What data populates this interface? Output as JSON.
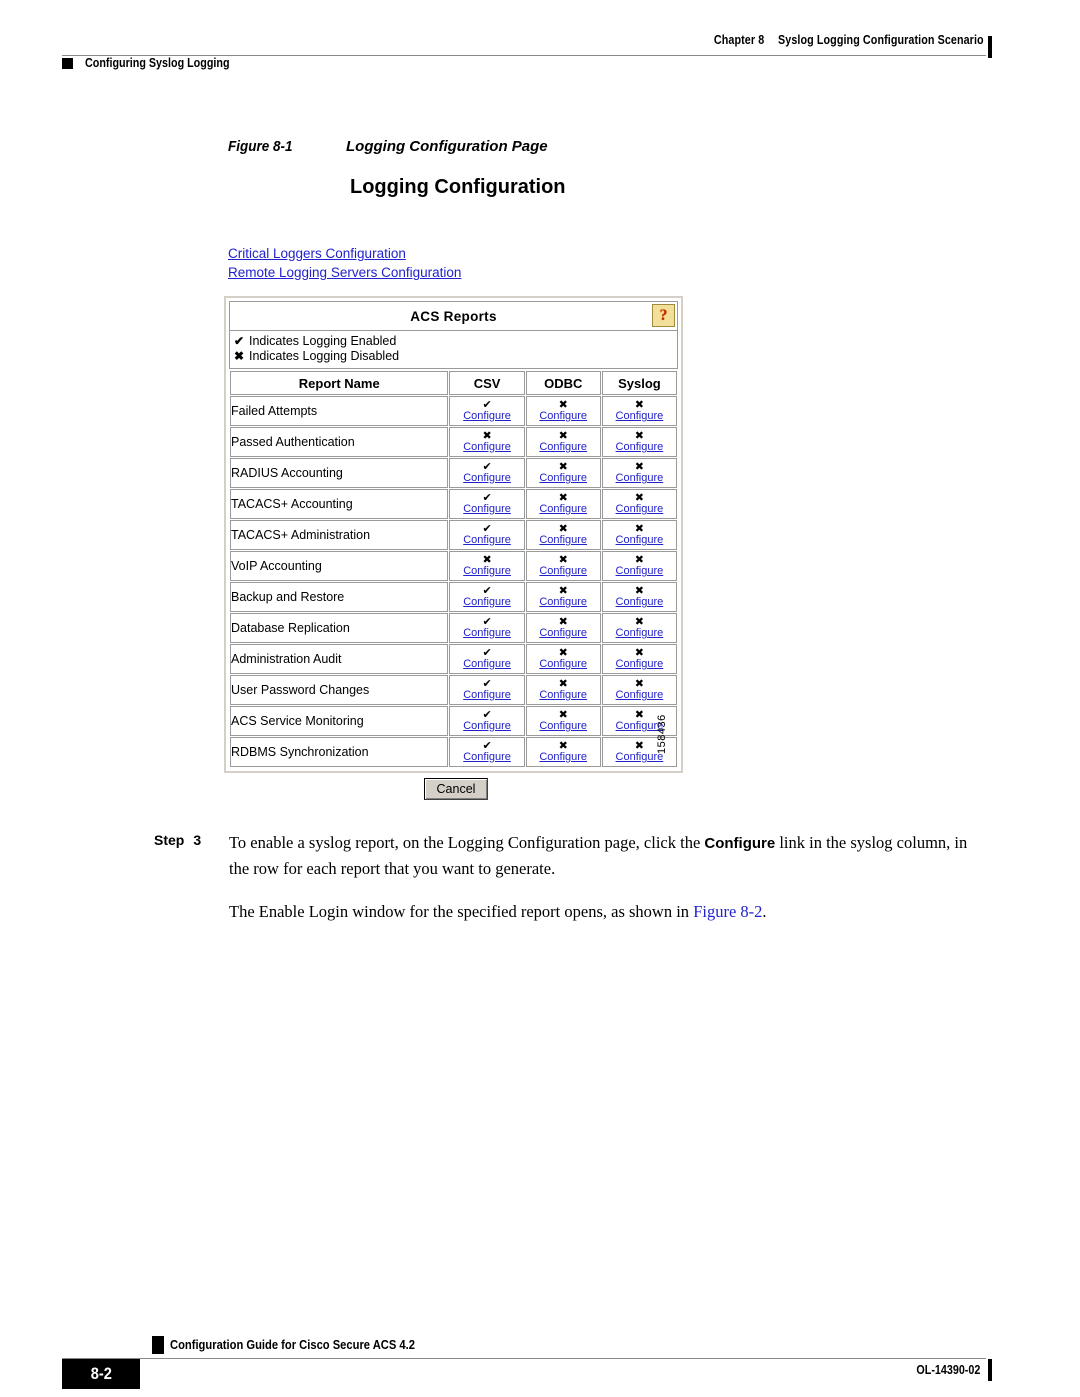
{
  "header": {
    "chapter": "Chapter 8",
    "chapter_title": "Syslog Logging Configuration Scenario",
    "section": "Configuring Syslog Logging"
  },
  "figure": {
    "number": "Figure 8-1",
    "title": "Logging Configuration Page",
    "figure_id": "158436"
  },
  "screenshot": {
    "page_title": "Logging Configuration",
    "links": [
      {
        "label": "Critical Loggers Configuration"
      },
      {
        "label": "Remote Logging Servers Configuration"
      }
    ],
    "panel": {
      "title": "ACS Reports",
      "help_icon": "question-mark-icon",
      "help_glyph": "?",
      "legend": [
        {
          "glyph": "✔",
          "text": "Indicates Logging Enabled"
        },
        {
          "glyph": "✖",
          "text": "Indicates Logging Disabled"
        }
      ],
      "columns": [
        "Report Name",
        "CSV",
        "ODBC",
        "Syslog"
      ],
      "configure_label": "Configure",
      "enabled_glyph": "✔",
      "disabled_glyph": "✖",
      "rows": [
        {
          "name": "Failed Attempts",
          "csv": true,
          "odbc": false,
          "syslog": false
        },
        {
          "name": "Passed Authentication",
          "csv": false,
          "odbc": false,
          "syslog": false
        },
        {
          "name": "RADIUS Accounting",
          "csv": true,
          "odbc": false,
          "syslog": false
        },
        {
          "name": "TACACS+ Accounting",
          "csv": true,
          "odbc": false,
          "syslog": false
        },
        {
          "name": "TACACS+ Administration",
          "csv": true,
          "odbc": false,
          "syslog": false
        },
        {
          "name": "VoIP Accounting",
          "csv": false,
          "odbc": false,
          "syslog": false
        },
        {
          "name": "Backup and Restore",
          "csv": true,
          "odbc": false,
          "syslog": false
        },
        {
          "name": "Database Replication",
          "csv": true,
          "odbc": false,
          "syslog": false
        },
        {
          "name": "Administration Audit",
          "csv": true,
          "odbc": false,
          "syslog": false
        },
        {
          "name": "User Password Changes",
          "csv": true,
          "odbc": false,
          "syslog": false
        },
        {
          "name": "ACS Service Monitoring",
          "csv": true,
          "odbc": false,
          "syslog": false
        },
        {
          "name": "RDBMS Synchronization",
          "csv": true,
          "odbc": false,
          "syslog": false
        }
      ]
    },
    "cancel_label": "Cancel"
  },
  "step": {
    "label": "Step",
    "number": "3",
    "text_part1": "To enable a syslog report, on the Logging Configuration page, click the ",
    "bold_term": "Configure",
    "text_part2": " link in the syslog column, in the row for each report that you want to generate.",
    "paragraph2_part1": "The Enable Login window for the specified report opens, as shown in ",
    "paragraph2_xref": "Figure 8-2",
    "paragraph2_part2": "."
  },
  "footer": {
    "title": "Configuration Guide for Cisco Secure ACS 4.2",
    "page_number": "8-2",
    "doc_id": "OL-14390-02"
  },
  "colors": {
    "link": "#2222cc",
    "panel_border": "#d4d0c8",
    "cell_border": "#9a9a9a",
    "help_bg": "#f2e09a",
    "help_glyph": "#cc2200",
    "button_face": "#d4d0c8"
  }
}
